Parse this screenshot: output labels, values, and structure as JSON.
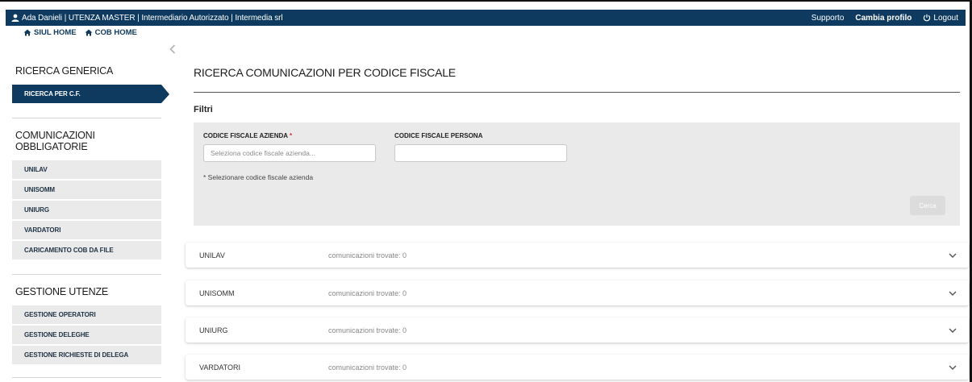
{
  "header": {
    "user_text": "Ada Danieli | UTENZA MASTER | Intermediario Autorizzato | Intermedia srl",
    "support": "Supporto",
    "change_profile": "Cambia profilo",
    "logout": "Logout",
    "bg_color": "#0e3a5f"
  },
  "breadcrumbs": {
    "siul_home": "SIUL HOME",
    "cob_home": "COB HOME"
  },
  "sidebar": {
    "ricerca_title": "RICERCA GENERICA",
    "ricerca_items": [
      {
        "label": "RICERCA PER C.F."
      }
    ],
    "comunicazioni_title": "COMUNICAZIONI OBBLIGATORIE",
    "comunicazioni_items": [
      {
        "label": "UNILAV"
      },
      {
        "label": "UNISOMM"
      },
      {
        "label": "UNIURG"
      },
      {
        "label": "VARDATORI"
      },
      {
        "label": "CARICAMENTO COB DA FILE"
      }
    ],
    "gestione_title": "GESTIONE UTENZE",
    "gestione_items": [
      {
        "label": "GESTIONE OPERATORI"
      },
      {
        "label": "GESTIONE DELEGHE"
      },
      {
        "label": "GESTIONE RICHIESTE DI DELEGA"
      }
    ]
  },
  "main": {
    "title": "RICERCA COMUNICAZIONI PER CODICE FISCALE",
    "filters_label": "Filtri",
    "cf_azienda_label": "CODICE FISCALE AZIENDA",
    "cf_azienda_required": "*",
    "cf_azienda_placeholder": "Seleziona codice fiscale azienda...",
    "cf_azienda_value": "",
    "cf_persona_label": "CODICE FISCALE PERSONA",
    "cf_persona_value": "",
    "note": "* Selezionare codice fiscale azienda",
    "search_button": "Cerca"
  },
  "results": [
    {
      "name": "UNILAV",
      "count_text": "comunicazioni trovate: 0"
    },
    {
      "name": "UNISOMM",
      "count_text": "comunicazioni trovate: 0"
    },
    {
      "name": "UNIURG",
      "count_text": "comunicazioni trovate: 0"
    },
    {
      "name": "VARDATORI",
      "count_text": "comunicazioni trovate: 0"
    }
  ],
  "icons": {
    "user": "user-icon",
    "home": "home-icon",
    "power": "power-icon",
    "chevron_left": "chevron-left-icon",
    "chevron_down": "chevron-down-icon"
  }
}
